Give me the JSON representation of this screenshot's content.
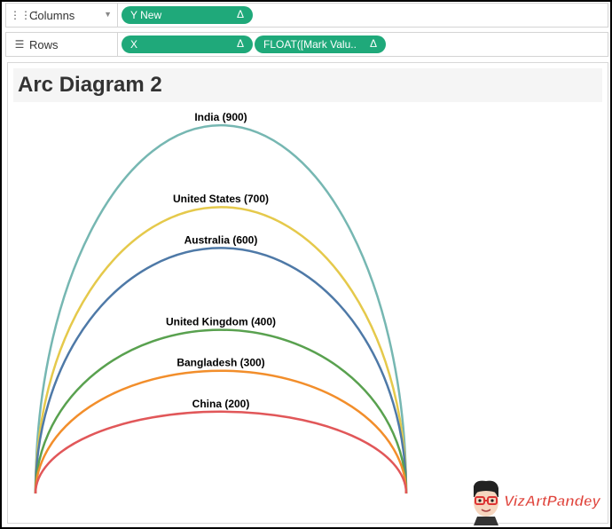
{
  "shelves": {
    "columns": {
      "label": "Columns",
      "pills": [
        {
          "text": "Y New",
          "delta": "Δ"
        }
      ]
    },
    "rows": {
      "label": "Rows",
      "pills": [
        {
          "text": "X",
          "delta": "Δ"
        },
        {
          "text": "FLOAT([Mark Valu..",
          "delta": "Δ"
        }
      ]
    }
  },
  "sheet": {
    "title": "Arc Diagram 2"
  },
  "logo": {
    "text": "VizArtPandey"
  },
  "colors": {
    "pill": "#1fa97a",
    "logo": "#e0463e"
  },
  "chart_data": {
    "type": "line",
    "title": "Arc Diagram 2",
    "xlabel": "",
    "ylabel": "",
    "ylim": [
      0,
      900
    ],
    "grid": false,
    "series": [
      {
        "label": "India (900)",
        "value": 900,
        "color": "#76b7b2"
      },
      {
        "label": "United States (700)",
        "value": 700,
        "color": "#e5c94b"
      },
      {
        "label": "Australia (600)",
        "value": 600,
        "color": "#4e79a7"
      },
      {
        "label": "United Kingdom (400)",
        "value": 400,
        "color": "#59a14f"
      },
      {
        "label": "Bangladesh (300)",
        "value": 300,
        "color": "#f28e2b"
      },
      {
        "label": "China (200)",
        "value": 200,
        "color": "#e15759"
      }
    ]
  }
}
